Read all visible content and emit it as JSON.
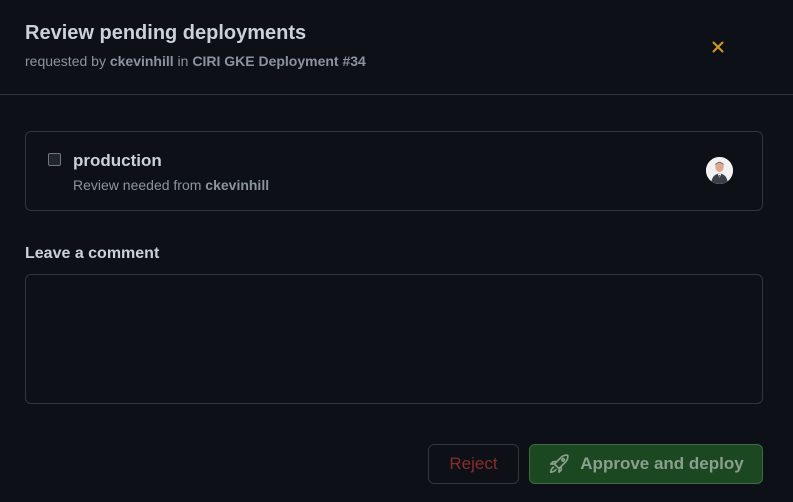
{
  "header": {
    "title": "Review pending deployments",
    "subtitle_prefix": "requested by ",
    "requester": "ckevinhill",
    "subtitle_mid": " in ",
    "workflow_run": "CIRI GKE Deployment #34"
  },
  "environment": {
    "name": "production",
    "review_prefix": "Review needed from ",
    "reviewer": "ckevinhill",
    "checked": false
  },
  "comment": {
    "label": "Leave a comment",
    "value": "",
    "placeholder": ""
  },
  "actions": {
    "reject_label": "Reject",
    "approve_label": "Approve and deploy"
  },
  "icons": {
    "close": "close-icon",
    "rocket": "rocket-icon",
    "avatar": "user-avatar"
  },
  "colors": {
    "background": "#0d1117",
    "close_icon": "#d29922",
    "reject_text": "#8b2a2a",
    "approve_bg": "#1b4721",
    "border": "#30363d"
  }
}
